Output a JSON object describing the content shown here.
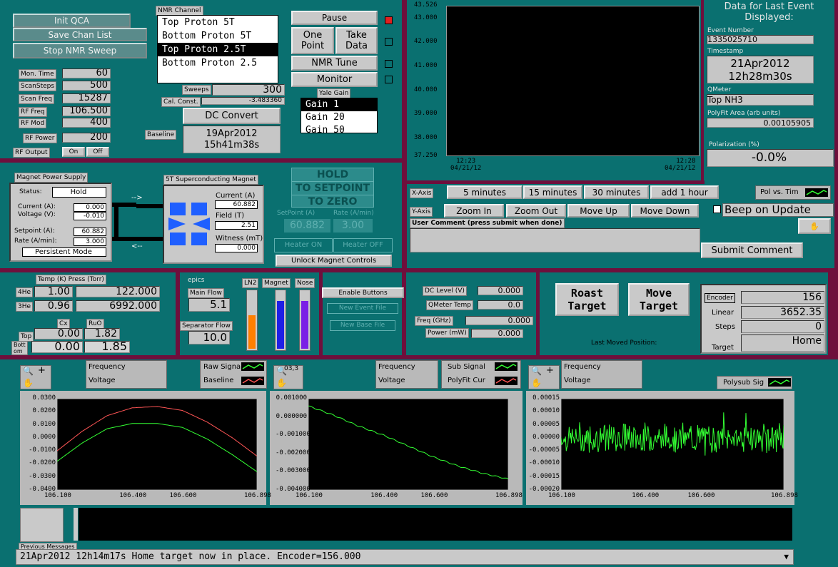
{
  "colors": {
    "background": "#0a7070",
    "separator": "#6e0f3c",
    "plot_bg": "#000000",
    "trace_green": "#33ff33",
    "trace_red": "#ff5555",
    "button": "#5a8b8b"
  },
  "top_left": {
    "init_qca": "Init QCA",
    "save_chan": "Save Chan List",
    "stop_sweep": "Stop NMR Sweep",
    "params": [
      {
        "label": "Mon. Time",
        "value": "60"
      },
      {
        "label": "ScanSteps",
        "value": "500"
      },
      {
        "label": "Scan Freq",
        "value": "15287"
      },
      {
        "label": "RF Freq",
        "value": "106.500"
      },
      {
        "label": "RF Mod",
        "value": "400"
      },
      {
        "label": "RF Power",
        "value": "200"
      }
    ],
    "rf_output": "RF Output",
    "on": "On",
    "off": "Off"
  },
  "nmr": {
    "title": "NMR Channel",
    "channels": [
      "Top Proton 5T",
      "Bottom Proton 5T",
      "Top Proton 2.5T",
      "Bottom Proton 2.5"
    ],
    "selected": 2,
    "sweeps_label": "Sweeps",
    "sweeps": "300",
    "cal_label": "Cal. Const.",
    "cal": "-3.483360",
    "dc_convert": "DC Convert",
    "baseline_label": "Baseline",
    "baseline_date": "19Apr2012",
    "baseline_time": "15h41m38s"
  },
  "controls": {
    "pause": "Pause",
    "one_point": [
      "One",
      "Point"
    ],
    "take_data": [
      "Take",
      "Data"
    ],
    "nmr_tune": "NMR Tune",
    "monitor": "Monitor",
    "yale_gain": "Yale Gain",
    "gains": [
      "Gain 1",
      "Gain 20",
      "Gain 50"
    ],
    "gain_selected": 0
  },
  "pol_chart": {
    "xlabels": [
      {
        "time": "12:23",
        "date": "04/21/12"
      },
      {
        "time": "12:28",
        "date": "04/21/12"
      }
    ],
    "x_axis_label": "X-Axis",
    "y_axis_label": "Y-Axis",
    "x_buttons": [
      "5 minutes",
      "15 minutes",
      "30 minutes",
      "add 1 hour"
    ],
    "y_buttons": [
      "Zoom In",
      "Zoom Out",
      "Move Up",
      "Move Down"
    ],
    "pol_vs_time": "Pol vs. Tim",
    "beep": "Beep on Update",
    "comment_label": "User Comment (press submit when done)",
    "submit": "Submit Comment"
  },
  "chart_data": [
    {
      "type": "line",
      "ylim": [
        37.25,
        43.526
      ],
      "yticks": [
        "43.526",
        "43.000",
        "42.000",
        "41.000",
        "40.000",
        "39.000",
        "38.000",
        "37.250"
      ],
      "series": []
    },
    {
      "type": "line",
      "x": [
        106.1,
        106.2,
        106.3,
        106.4,
        106.5,
        106.6,
        106.7,
        106.8,
        106.898
      ],
      "xticks": [
        "106.100",
        "106.400",
        "106.600",
        "106.898"
      ],
      "ylim": [
        -0.04,
        0.03
      ],
      "yticks": [
        "0.0300",
        "0.0200",
        "0.0100",
        "0.0000",
        "-0.0100",
        "-0.0200",
        "-0.0300",
        "-0.0400"
      ],
      "series": [
        {
          "values": [
            -0.01,
            0.005,
            0.017,
            0.023,
            0.024,
            0.021,
            0.012,
            0.0,
            -0.014
          ],
          "color": "#ff5555"
        },
        {
          "values": [
            -0.018,
            -0.004,
            0.007,
            0.011,
            0.011,
            0.008,
            -0.001,
            -0.013,
            -0.026
          ],
          "color": "#33ff33"
        }
      ]
    },
    {
      "type": "line",
      "x": [
        106.1,
        106.2,
        106.3,
        106.4,
        106.5,
        106.6,
        106.7,
        106.8,
        106.898
      ],
      "xticks": [
        "106.100",
        "106.400",
        "106.600",
        "106.898"
      ],
      "ylim": [
        -0.004,
        0.001
      ],
      "yticks": [
        "0.001000",
        "0.000000",
        "-0.001000",
        "-0.002000",
        "-0.003000",
        "-0.004000"
      ],
      "series": [
        {
          "values": [
            0.0006,
            0.0001,
            -0.0005,
            -0.001,
            -0.0016,
            -0.0022,
            -0.0027,
            -0.0031,
            -0.0034
          ],
          "color": "#33ff33"
        }
      ]
    },
    {
      "type": "line",
      "x": [
        106.1,
        106.898
      ],
      "xticks": [
        "106.100",
        "106.400",
        "106.600",
        "106.898"
      ],
      "ylim": [
        -0.0002,
        0.00015
      ],
      "yticks": [
        "0.00015",
        "0.00010",
        "0.00005",
        "0.00000",
        "-0.00005",
        "-0.00010",
        "-0.00015",
        "-0.00020"
      ],
      "series": [
        {
          "values": [
            0,
            0
          ],
          "color": "#33ff33",
          "note": "noise"
        }
      ]
    }
  ],
  "last_event": {
    "title": [
      "Data for Last Event",
      "Displayed:"
    ],
    "event_label": "Event Number",
    "event": "1335025710",
    "ts_label": "Timestamp",
    "ts_date": "21Apr2012",
    "ts_time": "12h28m30s",
    "qmeter_label": "QMeter",
    "qmeter": "Top NH3",
    "polyfit_label": "PolyFit Area (arb units)",
    "polyfit": "0.00105905",
    "pol_label": "Polarization (%)",
    "pol": "-0.0%"
  },
  "magnet": {
    "psu_title": "Magnet Power Supply",
    "status_label": "Status:",
    "status": "Hold",
    "current_label": "Current (A):",
    "current": "0.000",
    "voltage_label": "Voltage (V):",
    "voltage": "-0.010",
    "setpoint_label": "Setpoint (A):",
    "setpoint": "60.882",
    "rate_label": "Rate (A/min):",
    "rate": "3.000",
    "persistent": "Persistent Mode",
    "sc_title": "5T Superconducting Magnet",
    "sc_current_label": "Current (A)",
    "sc_current": "60.882",
    "sc_field_label": "Field (T)",
    "sc_field": "2.51",
    "sc_witness_label": "Witness (mT)",
    "sc_witness": "0.000",
    "arrow_in": "-->",
    "arrow_out": "<--",
    "hold": "HOLD",
    "to_setpoint": "TO SETPOINT",
    "to_zero": "TO ZERO",
    "sp_label": "SetPoint (A)",
    "rate2_label": "Rate (A/min)",
    "sp_val": "60.882",
    "rate_val": "3.00",
    "heater_on": "Heater ON",
    "heater_off": "Heater OFF",
    "unlock": "Unlock Magnet Controls"
  },
  "temps": {
    "header": "Temp (K) Press (Torr)",
    "he4_label": "4He",
    "he4_t": "1.00",
    "he4_p": "122.000",
    "he3_label": "3He",
    "he3_t": "0.96",
    "he3_p": "6992.000",
    "cx": "Cx",
    "ruo": "RuO",
    "top_label": "Top",
    "top_cx": "0.00",
    "top_ruo": "1.82",
    "bott_label": [
      "Bott",
      "om"
    ],
    "bott_cx": "0.00",
    "bott_ruo": "1.85"
  },
  "epics": {
    "title": "epics",
    "main_flow_label": "Main Flow",
    "main_flow": "5.1",
    "sep_flow_label": "Separator Flow",
    "sep_flow": "10.0",
    "bars": [
      {
        "label": "LN2",
        "level": 0.57,
        "color": "#ff7f00"
      },
      {
        "label": "Magnet",
        "level": 0.82,
        "color": "#1f1fe6"
      },
      {
        "label": "Nose",
        "level": 0.82,
        "color": "#7a1fe6"
      }
    ]
  },
  "enable": {
    "enable": "Enable Buttons",
    "new_event": "New Event File",
    "new_base": "New Base File"
  },
  "dc": {
    "dc_label": "DC Level (V)",
    "dc": "0.000",
    "qt_label": "QMeter Temp",
    "qt": "0.0",
    "freq_label": "Freq (GHz)",
    "freq": "0.000",
    "power_label": "Power (mW)",
    "power": "0.000"
  },
  "target": {
    "roast": [
      "Roast",
      "Target"
    ],
    "move": [
      "Move",
      "Target"
    ],
    "last_moved": "Last Moved Position:",
    "encoder_label": "Encoder",
    "encoder": "156",
    "linear_label": "Linear",
    "linear": "3652.35",
    "steps_label": "Steps",
    "steps": "0",
    "target_label": "Target",
    "target": "Home"
  },
  "signals": {
    "freq": "Frequency",
    "volt": "Voltage",
    "raw": "Raw Signa",
    "baseline": "Baseline",
    "sub": "Sub Signal",
    "polyfit": "PolyFit Cur",
    "polysub": "Polysub Sig",
    "overlap": "03,3"
  },
  "messages": {
    "label": "Previous Messages",
    "text": "21Apr2012 12h14m17s Home target now in place.  Encoder=156.000"
  }
}
